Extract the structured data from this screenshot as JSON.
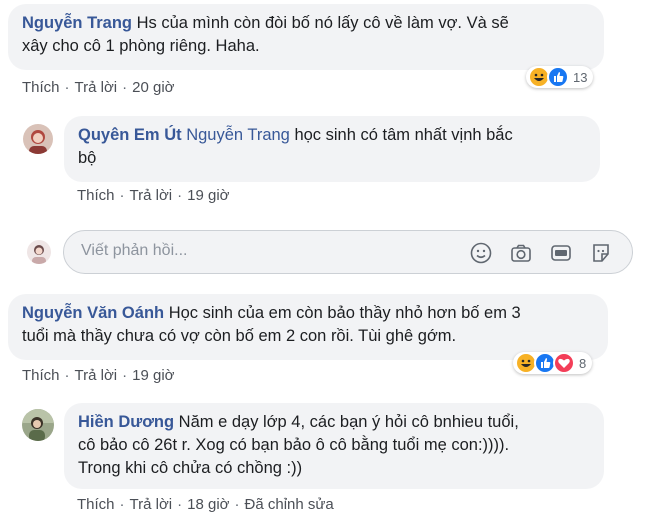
{
  "colors": {
    "link": "#385898",
    "bubble_bg": "#f2f3f5",
    "meta_text": "#606770",
    "haha": "#f7b125",
    "like": "#1877f2",
    "love": "#f33e58"
  },
  "actions": {
    "like": "Thích",
    "reply": "Trả lời",
    "edited": "Đã chỉnh sửa",
    "separator": "·"
  },
  "comments": [
    {
      "author": "Nguyễn Trang",
      "text_line1": " Hs của mình còn đòi bố nó lấy cô về làm vợ. Và sẽ",
      "text_line2": "xây cho cô 1 phòng riêng. Haha.",
      "time": "20 giờ",
      "reactions": [
        "haha-icon",
        "like-icon"
      ],
      "reaction_count": "13"
    },
    {
      "author": "Quyên Em Út",
      "mention": "Nguyễn Trang",
      "text_line1": " học sinh có tâm nhất vịnh bắc",
      "text_line2": "bộ",
      "time": "19 giờ"
    },
    {
      "author": "Nguyễn Văn Oánh",
      "text_line1": " Học sinh của em còn bảo thầy nhỏ hơn bố em 3",
      "text_line2": "tuổi mà thầy chưa có vợ còn bố em 2 con rồi. Tùi ghê gớm.",
      "time": "19 giờ",
      "reactions": [
        "haha-icon",
        "like-icon",
        "love-icon"
      ],
      "reaction_count": "8"
    },
    {
      "author": "Hiền Dương",
      "text_line1": " Năm e dạy lớp 4, các bạn ý hỏi cô bnhieu tuổi,",
      "text_line2": "cô bảo cô 26t r. Xog có bạn bảo ô cô bằng tuổi mẹ con:)))).",
      "text_line3": "Trong khi cô chửa có chồng :))",
      "time": "18 giờ"
    }
  ],
  "reply_input": {
    "placeholder": "Viết phản hồi...",
    "icons": [
      "emoji-icon",
      "camera-icon",
      "gif-icon",
      "sticker-icon"
    ]
  }
}
